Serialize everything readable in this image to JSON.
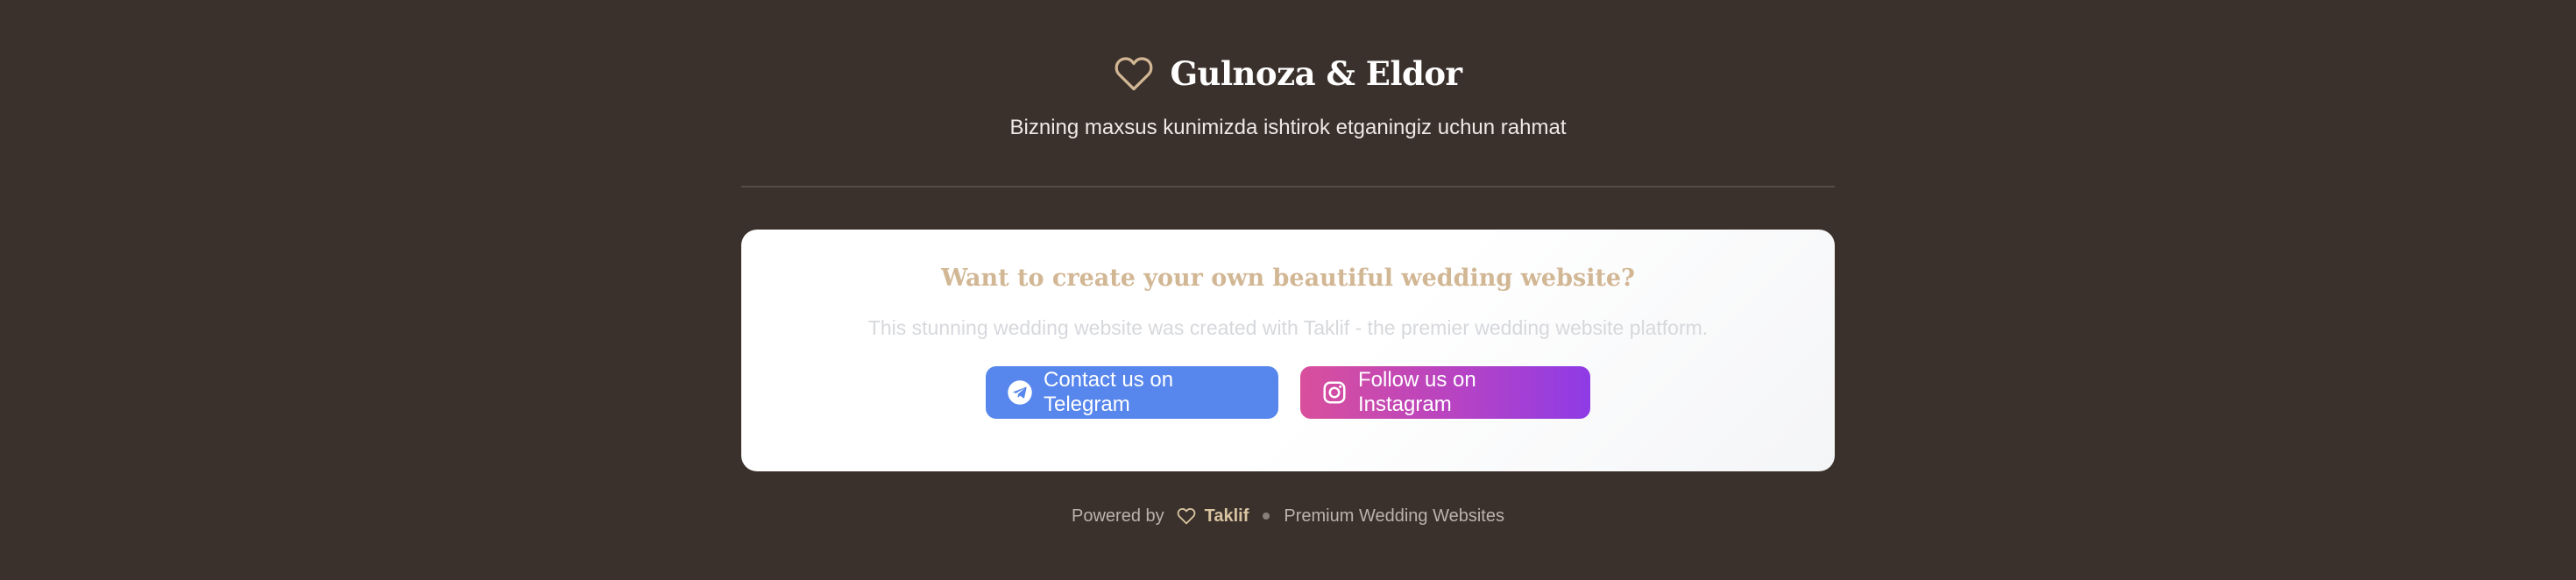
{
  "header": {
    "couple_names": "Gulnoza & Eldor",
    "tagline": "Bizning maxsus kunimizda ishtirok etganingiz uchun rahmat",
    "icon": "heart-outline-icon"
  },
  "promo": {
    "title": "Want to create your own beautiful wedding website?",
    "description": "This stunning wedding website was created with Taklif - the premier wedding website platform.",
    "telegram_button": {
      "label": "Contact us on Telegram",
      "icon": "telegram-icon",
      "color": "#5786ec"
    },
    "instagram_button": {
      "label": "Follow us on Instagram",
      "icon": "instagram-icon",
      "gradient": [
        "#d94f9c",
        "#8e3be6"
      ]
    }
  },
  "footer": {
    "powered_by": "Powered by",
    "brand": "Taklif",
    "tagline": "Premium Wedding Websites"
  },
  "colors": {
    "background": "#3b312c",
    "accent_gold": "#d2b795",
    "card_background": "#ffffff"
  }
}
